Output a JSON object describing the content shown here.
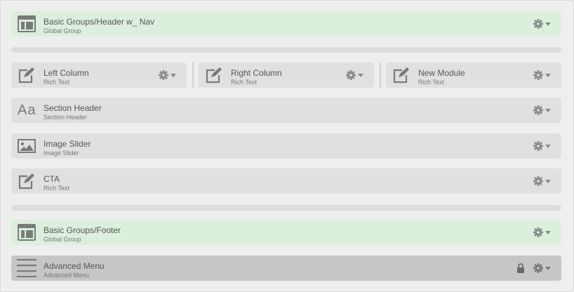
{
  "modules": [
    {
      "title": "Basic Groups/Header w_ Nav",
      "subtitle": "Global Group",
      "icon": "layout-icon"
    },
    {
      "title": "Left Column",
      "subtitle": "Rich Text",
      "icon": "edit-icon"
    },
    {
      "title": "Right Column",
      "subtitle": "Rich Text",
      "icon": "edit-icon"
    },
    {
      "title": "New Module",
      "subtitle": "Rich Text",
      "icon": "edit-icon"
    },
    {
      "title": "Section Header",
      "subtitle": "Section Header",
      "icon": "text-icon",
      "icon_text": "Aa"
    },
    {
      "title": "Image Slider",
      "subtitle": "Image Slider",
      "icon": "image-icon"
    },
    {
      "title": "CTA",
      "subtitle": "Rich Text",
      "icon": "edit-icon"
    },
    {
      "title": "Basic Groups/Footer",
      "subtitle": "Global Group",
      "icon": "layout-icon"
    },
    {
      "title": "Advanced Menu",
      "subtitle": "Advanced Menu",
      "icon": "menu-icon",
      "locked": true
    }
  ],
  "colors": {
    "global_group_bg": "#dcefdc",
    "module_bg": "#e0e0e0",
    "advanced_bg": "#c6c6c6",
    "icon_color": "#7a7a7a"
  }
}
